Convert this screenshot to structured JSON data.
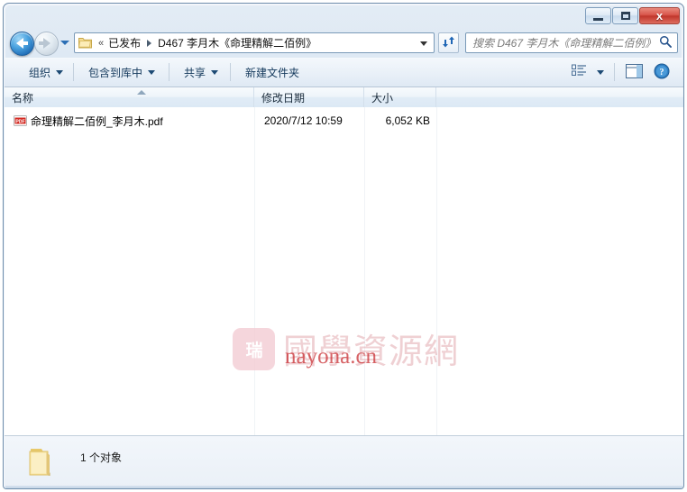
{
  "window": {
    "minimize_label": "最小化",
    "maximize_label": "最大化",
    "close_label": "关闭",
    "close_glyph": "x"
  },
  "nav": {
    "back_label": "后退",
    "forward_label": "前进",
    "history_label": "最近浏览的位置",
    "refresh_label": "刷新"
  },
  "address": {
    "overflow_glyph": "«",
    "crumbs": [
      {
        "label": "已发布"
      },
      {
        "label": "D467 李月木《命理精解二佰例》"
      }
    ],
    "dropdown_label": "以前的位置"
  },
  "search": {
    "placeholder": "搜索 D467 李月木《命理精解二佰例》",
    "icon": "search-icon"
  },
  "toolbar": {
    "items": [
      {
        "label": "组织",
        "has_caret": true
      },
      {
        "label": "包含到库中",
        "has_caret": true
      },
      {
        "label": "共享",
        "has_caret": true
      },
      {
        "label": "新建文件夹",
        "has_caret": false
      }
    ],
    "view_mode_label": "更改您的视图",
    "preview_pane_label": "显示预览窗格",
    "help_label": "获取帮助",
    "help_glyph": "?"
  },
  "columns": [
    {
      "key": "name",
      "label": "名称",
      "sorted": true,
      "sort_dir": "asc"
    },
    {
      "key": "date",
      "label": "修改日期",
      "sorted": false
    },
    {
      "key": "size",
      "label": "大小",
      "sorted": false
    },
    {
      "key": "blank",
      "label": "",
      "sorted": false
    }
  ],
  "files": [
    {
      "name": "命理精解二佰例_李月木.pdf",
      "date": "2020/7/12 10:59",
      "size": "6,052 KB",
      "icon": "pdf-file-icon",
      "icon_label": "PDF"
    }
  ],
  "watermark": {
    "seal_glyph": "瑞",
    "cn_text": "國學資源網",
    "url_text": "nayona.cn"
  },
  "statusbar": {
    "text": "1 个对象",
    "folder_icon": "folder-icon"
  },
  "colors": {
    "accent_blue": "#1863ae",
    "close_red": "#c0362b",
    "pdf_red": "#d32a22",
    "watermark_pink": "#f3cbd3",
    "watermark_red": "#c8282d",
    "folder_yellow": "#f5d87a"
  }
}
